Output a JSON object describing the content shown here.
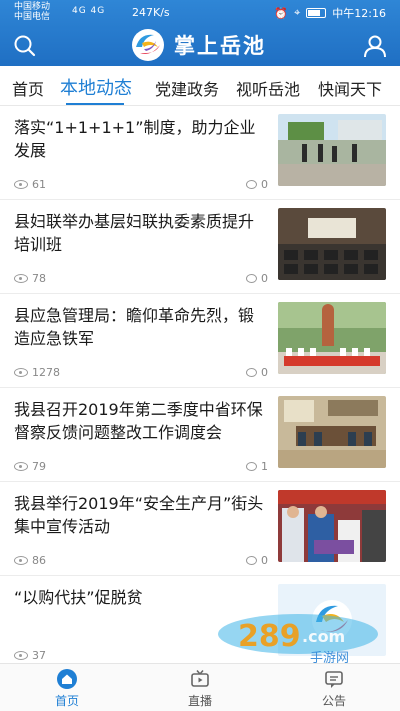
{
  "status_bar": {
    "carrier1": "中国移动",
    "carrier2": "中国电信",
    "signal": "4G 4G",
    "speed": "247K/s",
    "battery": "75",
    "time": "中午12:16"
  },
  "header": {
    "app_title": "掌上岳池"
  },
  "tabs": [
    {
      "label": "首页"
    },
    {
      "label": "本地动态"
    },
    {
      "label": "党建政务"
    },
    {
      "label": "视听岳池"
    },
    {
      "label": "快闻天下"
    }
  ],
  "articles": [
    {
      "title": "落实“1+1+1+1”制度，助力企业发展",
      "views": "61",
      "comments": "0"
    },
    {
      "title": "县妇联举办基层妇联执委素质提升培训班",
      "views": "78",
      "comments": "0"
    },
    {
      "title": "县应急管理局：瞻仰革命先烈，锻造应急铁军",
      "views": "1278",
      "comments": "0"
    },
    {
      "title": "我县召开2019年第二季度中省环保督察反馈问题整改工作调度会",
      "views": "79",
      "comments": "1"
    },
    {
      "title": "我县举行2019年“安全生产月”街头集中宣传活动",
      "views": "86",
      "comments": "0"
    },
    {
      "title": "“以购代扶”促脱贫",
      "views": "37",
      "comments": ""
    }
  ],
  "bottom_nav": [
    {
      "label": "首页"
    },
    {
      "label": "直播"
    },
    {
      "label": "公告"
    }
  ],
  "colors": {
    "brand": "#1f6fc3",
    "accent": "#1f7fd4"
  }
}
